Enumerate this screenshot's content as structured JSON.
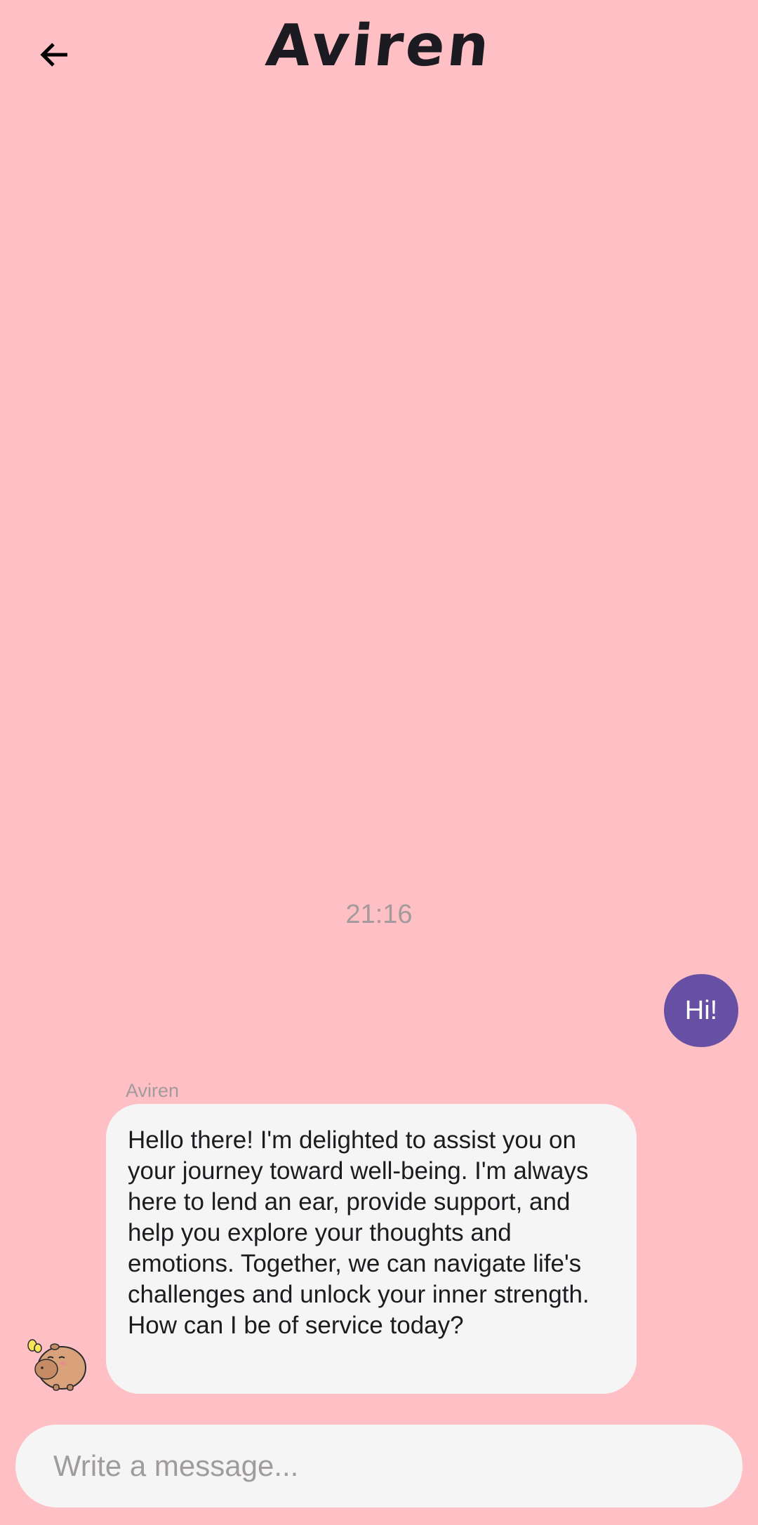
{
  "header": {
    "title": "Aviren",
    "back_icon": "arrow-left-icon"
  },
  "chat": {
    "timestamp": "21:16",
    "messages": [
      {
        "sender": "user",
        "text": "Hi!"
      },
      {
        "sender": "bot",
        "name": "Aviren",
        "text": "Hello there! I'm delighted to assist you on your journey toward well-being. I'm always here to lend an ear, provide support, and help you explore your thoughts and emotions. Together, we can navigate life's challenges and unlock your inner strength. How can I be of service today?",
        "avatar_icon": "capybara-avatar-icon"
      }
    ]
  },
  "composer": {
    "placeholder": "Write a message...",
    "value": ""
  },
  "colors": {
    "background": "#FFC0C5",
    "user_bubble": "#6750A4",
    "bot_bubble": "#F5F5F5",
    "muted_text": "#A29A9C"
  }
}
